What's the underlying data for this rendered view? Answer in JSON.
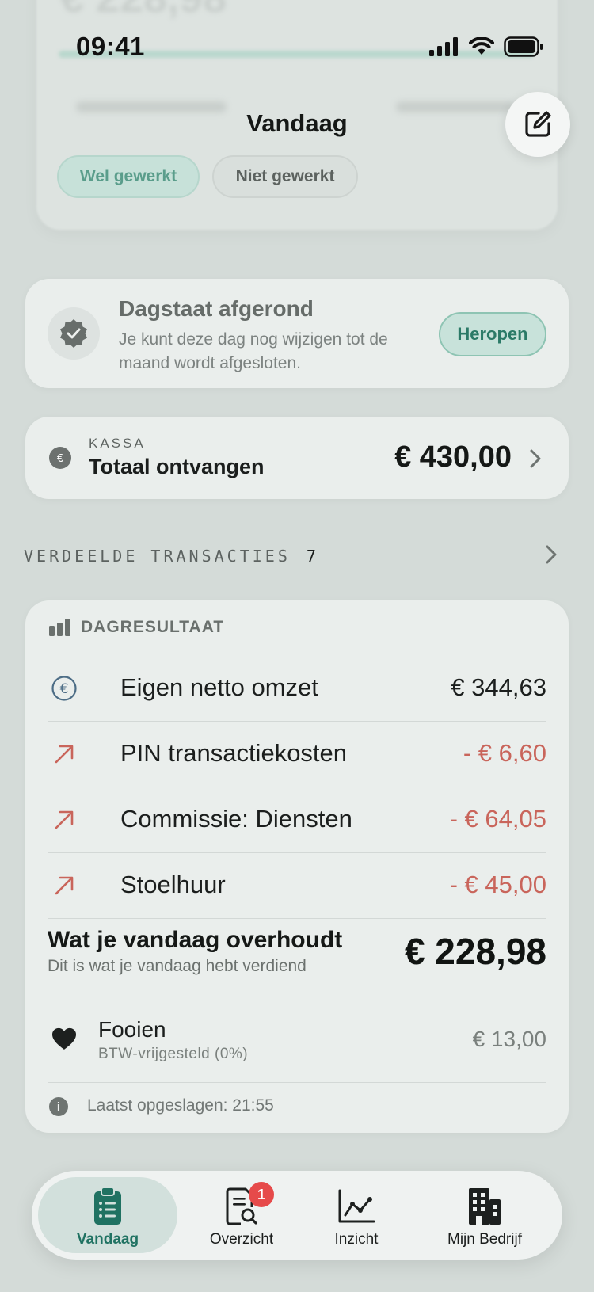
{
  "status_bar": {
    "time": "09:41"
  },
  "background": {
    "amount": "€ 228,98"
  },
  "header": {
    "title": "Vandaag",
    "toggle": {
      "worked": "Wel gewerkt",
      "not_worked": "Niet gewerkt",
      "selected": "Wel gewerkt"
    }
  },
  "day_closed": {
    "title": "Dagstaat afgerond",
    "text": "Je kunt deze dag nog wijzigen tot de maand wordt afgesloten.",
    "reopen_label": "Heropen"
  },
  "kassa": {
    "label": "KASSA",
    "title": "Totaal ontvangen",
    "amount": "€ 430,00"
  },
  "transactions": {
    "label": "VERDEELDE TRANSACTIES",
    "count": "7"
  },
  "result": {
    "header": "DAGRESULTAAT",
    "rows": [
      {
        "label": "Eigen netto omzet",
        "value": "€ 344,63"
      },
      {
        "label": "PIN transactiekosten",
        "value": "- € 6,60"
      },
      {
        "label": "Commissie: Diensten",
        "value": "- € 64,05"
      },
      {
        "label": "Stoelhuur",
        "value": "- € 45,00"
      }
    ],
    "summary": {
      "title": "Wat je vandaag overhoudt",
      "subtitle": "Dit is wat je vandaag hebt verdiend",
      "amount": "€ 228,98"
    },
    "tips": {
      "title": "Fooien",
      "subtitle": "BTW-vrijgesteld (0%)",
      "amount": "€ 13,00"
    },
    "last_saved": "Laatst opgeslagen: 21:55"
  },
  "tabbar": {
    "tabs": [
      {
        "label": "Vandaag",
        "active": true
      },
      {
        "label": "Overzicht",
        "badge": "1"
      },
      {
        "label": "Inzicht"
      },
      {
        "label": "Mijn Bedrijf"
      }
    ]
  },
  "colors": {
    "accent": "#207262",
    "negative": "#c9655b",
    "badge": "#e64a4a"
  }
}
